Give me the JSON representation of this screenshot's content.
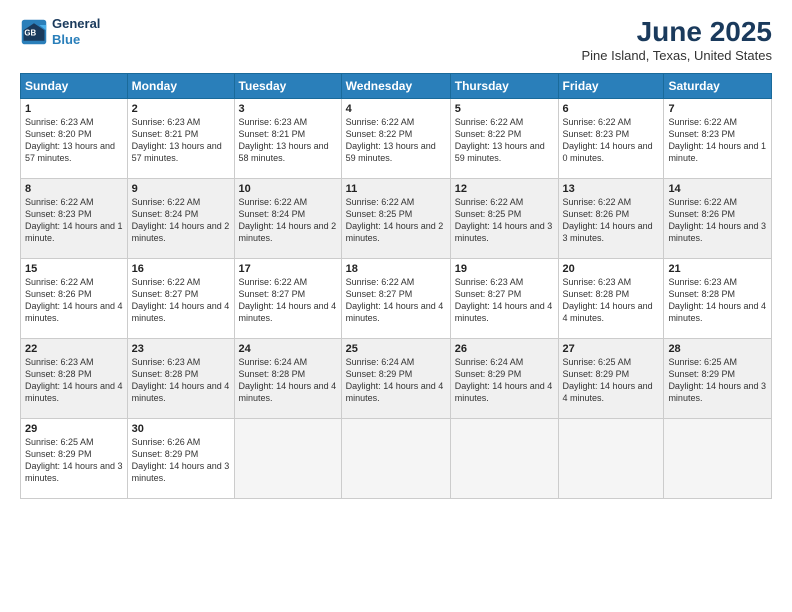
{
  "logo": {
    "line1": "General",
    "line2": "Blue"
  },
  "title": "June 2025",
  "subtitle": "Pine Island, Texas, United States",
  "days_of_week": [
    "Sunday",
    "Monday",
    "Tuesday",
    "Wednesday",
    "Thursday",
    "Friday",
    "Saturday"
  ],
  "weeks": [
    [
      {
        "day": "1",
        "sunrise": "6:23 AM",
        "sunset": "8:20 PM",
        "daylight": "13 hours and 57 minutes."
      },
      {
        "day": "2",
        "sunrise": "6:23 AM",
        "sunset": "8:21 PM",
        "daylight": "13 hours and 57 minutes."
      },
      {
        "day": "3",
        "sunrise": "6:23 AM",
        "sunset": "8:21 PM",
        "daylight": "13 hours and 58 minutes."
      },
      {
        "day": "4",
        "sunrise": "6:22 AM",
        "sunset": "8:22 PM",
        "daylight": "13 hours and 59 minutes."
      },
      {
        "day": "5",
        "sunrise": "6:22 AM",
        "sunset": "8:22 PM",
        "daylight": "13 hours and 59 minutes."
      },
      {
        "day": "6",
        "sunrise": "6:22 AM",
        "sunset": "8:23 PM",
        "daylight": "14 hours and 0 minutes."
      },
      {
        "day": "7",
        "sunrise": "6:22 AM",
        "sunset": "8:23 PM",
        "daylight": "14 hours and 1 minute."
      }
    ],
    [
      {
        "day": "8",
        "sunrise": "6:22 AM",
        "sunset": "8:23 PM",
        "daylight": "14 hours and 1 minute."
      },
      {
        "day": "9",
        "sunrise": "6:22 AM",
        "sunset": "8:24 PM",
        "daylight": "14 hours and 2 minutes."
      },
      {
        "day": "10",
        "sunrise": "6:22 AM",
        "sunset": "8:24 PM",
        "daylight": "14 hours and 2 minutes."
      },
      {
        "day": "11",
        "sunrise": "6:22 AM",
        "sunset": "8:25 PM",
        "daylight": "14 hours and 2 minutes."
      },
      {
        "day": "12",
        "sunrise": "6:22 AM",
        "sunset": "8:25 PM",
        "daylight": "14 hours and 3 minutes."
      },
      {
        "day": "13",
        "sunrise": "6:22 AM",
        "sunset": "8:26 PM",
        "daylight": "14 hours and 3 minutes."
      },
      {
        "day": "14",
        "sunrise": "6:22 AM",
        "sunset": "8:26 PM",
        "daylight": "14 hours and 3 minutes."
      }
    ],
    [
      {
        "day": "15",
        "sunrise": "6:22 AM",
        "sunset": "8:26 PM",
        "daylight": "14 hours and 4 minutes."
      },
      {
        "day": "16",
        "sunrise": "6:22 AM",
        "sunset": "8:27 PM",
        "daylight": "14 hours and 4 minutes."
      },
      {
        "day": "17",
        "sunrise": "6:22 AM",
        "sunset": "8:27 PM",
        "daylight": "14 hours and 4 minutes."
      },
      {
        "day": "18",
        "sunrise": "6:22 AM",
        "sunset": "8:27 PM",
        "daylight": "14 hours and 4 minutes."
      },
      {
        "day": "19",
        "sunrise": "6:23 AM",
        "sunset": "8:27 PM",
        "daylight": "14 hours and 4 minutes."
      },
      {
        "day": "20",
        "sunrise": "6:23 AM",
        "sunset": "8:28 PM",
        "daylight": "14 hours and 4 minutes."
      },
      {
        "day": "21",
        "sunrise": "6:23 AM",
        "sunset": "8:28 PM",
        "daylight": "14 hours and 4 minutes."
      }
    ],
    [
      {
        "day": "22",
        "sunrise": "6:23 AM",
        "sunset": "8:28 PM",
        "daylight": "14 hours and 4 minutes."
      },
      {
        "day": "23",
        "sunrise": "6:23 AM",
        "sunset": "8:28 PM",
        "daylight": "14 hours and 4 minutes."
      },
      {
        "day": "24",
        "sunrise": "6:24 AM",
        "sunset": "8:28 PM",
        "daylight": "14 hours and 4 minutes."
      },
      {
        "day": "25",
        "sunrise": "6:24 AM",
        "sunset": "8:29 PM",
        "daylight": "14 hours and 4 minutes."
      },
      {
        "day": "26",
        "sunrise": "6:24 AM",
        "sunset": "8:29 PM",
        "daylight": "14 hours and 4 minutes."
      },
      {
        "day": "27",
        "sunrise": "6:25 AM",
        "sunset": "8:29 PM",
        "daylight": "14 hours and 4 minutes."
      },
      {
        "day": "28",
        "sunrise": "6:25 AM",
        "sunset": "8:29 PM",
        "daylight": "14 hours and 3 minutes."
      }
    ],
    [
      {
        "day": "29",
        "sunrise": "6:25 AM",
        "sunset": "8:29 PM",
        "daylight": "14 hours and 3 minutes."
      },
      {
        "day": "30",
        "sunrise": "6:26 AM",
        "sunset": "8:29 PM",
        "daylight": "14 hours and 3 minutes."
      },
      {
        "day": "",
        "sunrise": "",
        "sunset": "",
        "daylight": ""
      },
      {
        "day": "",
        "sunrise": "",
        "sunset": "",
        "daylight": ""
      },
      {
        "day": "",
        "sunrise": "",
        "sunset": "",
        "daylight": ""
      },
      {
        "day": "",
        "sunrise": "",
        "sunset": "",
        "daylight": ""
      },
      {
        "day": "",
        "sunrise": "",
        "sunset": "",
        "daylight": ""
      }
    ]
  ],
  "labels": {
    "sunrise": "Sunrise:",
    "sunset": "Sunset:",
    "daylight": "Daylight:"
  }
}
